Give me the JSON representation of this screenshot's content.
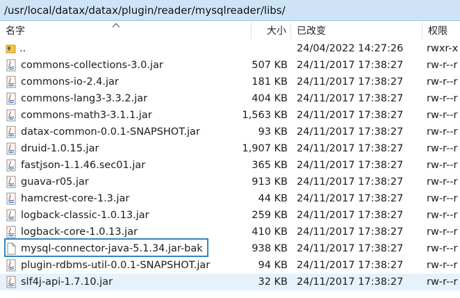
{
  "path": "/usr/local/datax/datax/plugin/reader/mysqlreader/libs/",
  "columns": {
    "name": "名字",
    "size": "大小",
    "modified": "已改变",
    "permissions": "权限"
  },
  "parent_row": {
    "name": "..",
    "modified": "24/04/2022 14:27:26",
    "permissions": "rwxr-x"
  },
  "files": [
    {
      "name": "commons-collections-3.0.jar",
      "size": "507 KB",
      "modified": "24/11/2017 17:38:27",
      "permissions": "rw-r--r",
      "icon": "jar-icon"
    },
    {
      "name": "commons-io-2.4.jar",
      "size": "181 KB",
      "modified": "24/11/2017 17:38:27",
      "permissions": "rw-r--r",
      "icon": "jar-icon"
    },
    {
      "name": "commons-lang3-3.3.2.jar",
      "size": "404 KB",
      "modified": "24/11/2017 17:38:27",
      "permissions": "rw-r--r",
      "icon": "jar-icon"
    },
    {
      "name": "commons-math3-3.1.1.jar",
      "size": "1,563 KB",
      "modified": "24/11/2017 17:38:27",
      "permissions": "rw-r--r",
      "icon": "jar-icon"
    },
    {
      "name": "datax-common-0.0.1-SNAPSHOT.jar",
      "size": "93 KB",
      "modified": "24/11/2017 17:38:27",
      "permissions": "rw-r--r",
      "icon": "jar-icon"
    },
    {
      "name": "druid-1.0.15.jar",
      "size": "1,907 KB",
      "modified": "24/11/2017 17:38:27",
      "permissions": "rw-r--r",
      "icon": "jar-icon"
    },
    {
      "name": "fastjson-1.1.46.sec01.jar",
      "size": "365 KB",
      "modified": "24/11/2017 17:38:27",
      "permissions": "rw-r--r",
      "icon": "jar-icon"
    },
    {
      "name": "guava-r05.jar",
      "size": "913 KB",
      "modified": "24/11/2017 17:38:27",
      "permissions": "rw-r--r",
      "icon": "jar-icon"
    },
    {
      "name": "hamcrest-core-1.3.jar",
      "size": "44 KB",
      "modified": "24/11/2017 17:38:27",
      "permissions": "rw-r--r",
      "icon": "jar-icon"
    },
    {
      "name": "logback-classic-1.0.13.jar",
      "size": "259 KB",
      "modified": "24/11/2017 17:38:27",
      "permissions": "rw-r--r",
      "icon": "jar-icon"
    },
    {
      "name": "logback-core-1.0.13.jar",
      "size": "410 KB",
      "modified": "24/11/2017 17:38:27",
      "permissions": "rw-r--r",
      "icon": "jar-icon"
    },
    {
      "name": "mysql-connector-java-5.1.34.jar-bak",
      "size": "938 KB",
      "modified": "24/11/2017 17:38:27",
      "permissions": "rw-r--r",
      "icon": "file-icon"
    },
    {
      "name": "plugin-rdbms-util-0.0.1-SNAPSHOT.jar",
      "size": "94 KB",
      "modified": "24/11/2017 17:38:27",
      "permissions": "rw-r--r",
      "icon": "jar-icon"
    },
    {
      "name": "slf4j-api-1.7.10.jar",
      "size": "32 KB",
      "modified": "24/11/2017 17:38:27",
      "permissions": "rw-r--r",
      "icon": "jar-icon"
    }
  ],
  "colors": {
    "path_bar": "#cfe3f7",
    "selected_row": "#e5f1fb",
    "highlight_border": "#2e86c1"
  }
}
